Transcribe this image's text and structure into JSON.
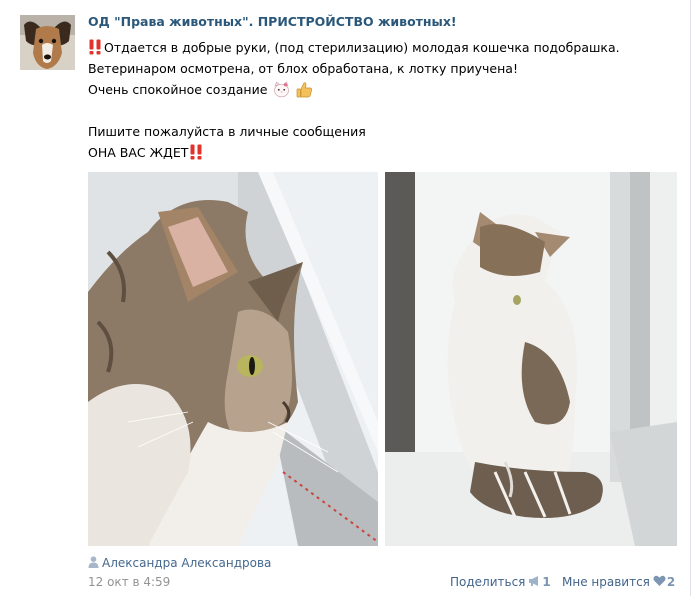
{
  "post": {
    "author": "ОД \"Права животных\". ПРИСТРОЙСТВО животных!",
    "lines": [
      "Отдается в добрые руки, (под стерилизацию) молодая кошечка подобрашка.",
      "Ветеринаром осмотрена, от блох обработана, к лотку приучена!",
      "Очень спокойное создание",
      "",
      "Пишите пожалуйста в личные сообщения",
      "ОНА ВАС ЖДЕТ"
    ],
    "icons": {
      "line1_prefix": "double-exclamation-icon",
      "line3_suffix_1": "cat-face-icon",
      "line3_suffix_2": "thumbs-up-icon",
      "line6_suffix": "double-exclamation-icon",
      "signer": "user-icon",
      "share": "megaphone-icon",
      "like": "heart-icon"
    },
    "photos": [
      {
        "subject": "tabby-white cat close-up at window"
      },
      {
        "subject": "tabby-white cat sitting on windowsill"
      }
    ],
    "signer": "Александра Александрова",
    "date": "12 окт в 4:59",
    "share": {
      "label": "Поделиться",
      "count": "1"
    },
    "like": {
      "label": "Мне нравится",
      "count": "2"
    }
  },
  "colors": {
    "link": "#2b587a",
    "signer": "#45688e",
    "meta": "#939393",
    "accent_red": "#e0332c"
  }
}
